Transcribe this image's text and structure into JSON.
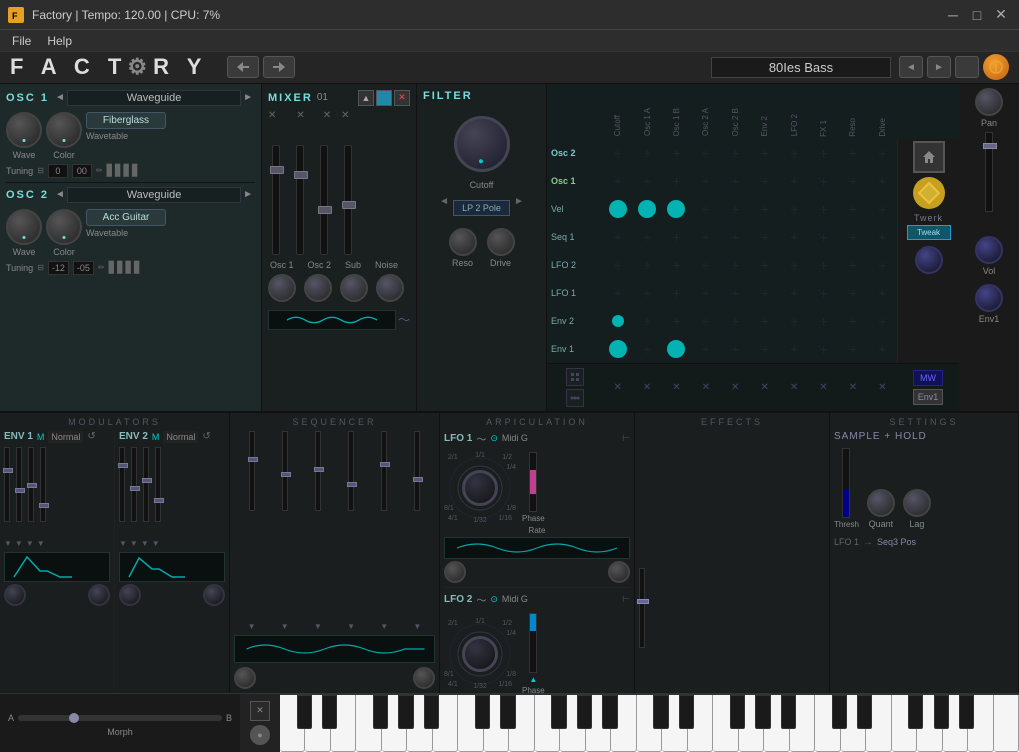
{
  "titlebar": {
    "title": "Factory | Tempo: 120.00 | CPU: 7%",
    "icon_text": "F",
    "min_label": "─",
    "max_label": "□",
    "close_label": "✕"
  },
  "menubar": {
    "items": [
      "File",
      "Help"
    ]
  },
  "header": {
    "logo": "FACTORY",
    "preset_name": "80Ies Bass",
    "nav_prev": "◄",
    "nav_next": "►",
    "save_btn": "□",
    "options_btn": "●"
  },
  "osc1": {
    "label": "OSC 1",
    "type": "Waveguide",
    "wave_label": "Wave",
    "color_label": "Color",
    "wavetable_label": "Wavetable",
    "wavetable_name": "Fiberglass",
    "tuning_label": "Tuning",
    "tuning_semi": "0",
    "tuning_cent": "00"
  },
  "osc2": {
    "label": "OSC 2",
    "type": "Waveguide",
    "wave_label": "Wave",
    "color_label": "Color",
    "wavetable_label": "Wavetable",
    "wavetable_name": "Acc Guitar",
    "tuning_label": "Tuning",
    "tuning_semi": "-12",
    "tuning_cent": "-05"
  },
  "mixer": {
    "label": "MIXER",
    "number": "01",
    "channels": [
      "Osc 1",
      "Osc 2",
      "Sub",
      "Noise"
    ],
    "vol_labels": [
      "Osc 1",
      "Osc 2",
      "Sub",
      "Noise"
    ]
  },
  "filter": {
    "label": "FILTER",
    "cutoff_label": "Cutoff",
    "type": "LP 2 Pole",
    "reso_label": "Reso",
    "drive_label": "Drive"
  },
  "mod_matrix": {
    "row_labels": [
      "Osc 2",
      "Osc 1",
      "Vel",
      "Seq 1",
      "LFO 2",
      "LFO 1",
      "Env 2",
      "Env 1"
    ],
    "col_labels": [
      "Cutoff",
      "Osc 1 A",
      "Osc 1 B",
      "Osc 2 A",
      "Osc 2 B",
      "Env 2",
      "LFO 2",
      "FX 1",
      "Reso",
      "Drive"
    ],
    "active_dots": [
      {
        "row": 2,
        "col": 0,
        "size": "large"
      },
      {
        "row": 2,
        "col": 1,
        "size": "large"
      },
      {
        "row": 2,
        "col": 2,
        "size": "large"
      },
      {
        "row": 6,
        "col": 0,
        "size": "small"
      },
      {
        "row": 7,
        "col": 0,
        "size": "large"
      },
      {
        "row": 7,
        "col": 2,
        "size": "large"
      }
    ],
    "twerk_label": "Twerk",
    "tweak_btn": "Tweak",
    "mw_btn": "MW",
    "env1_label": "Env1"
  },
  "modulators": {
    "section_title": "MODULATORS",
    "env1_label": "ENV 1",
    "env1_mode": "Normal",
    "env2_label": "ENV 2",
    "env2_mode": "Normal"
  },
  "sequencer": {
    "section_title": "SEQUENCER"
  },
  "arpiculation": {
    "section_title": "ARPICULATION",
    "lfo1_label": "LFO 1",
    "lfo1_sync": "Midi G",
    "lfo2_label": "LFO 2",
    "lfo2_sync": "Midi G",
    "rate_label": "Rate",
    "phase_label": "Phase"
  },
  "effects": {
    "section_title": "EFFECTS"
  },
  "settings": {
    "section_title": "SETTINGS",
    "sample_hold": "SAMPLE + HOLD",
    "quant_label": "Quant",
    "thresh_label": "Thresh",
    "lag_label": "Lag",
    "lfo_label": "LFO 1",
    "arrow": "→",
    "dest": "Seq3 Pos"
  },
  "right_panel": {
    "pan_label": "Pan",
    "vol_label": "Vol",
    "env1_label": "Env1"
  },
  "piano": {
    "morph_a": "A",
    "morph_b": "B",
    "morph_label": "Morph"
  }
}
